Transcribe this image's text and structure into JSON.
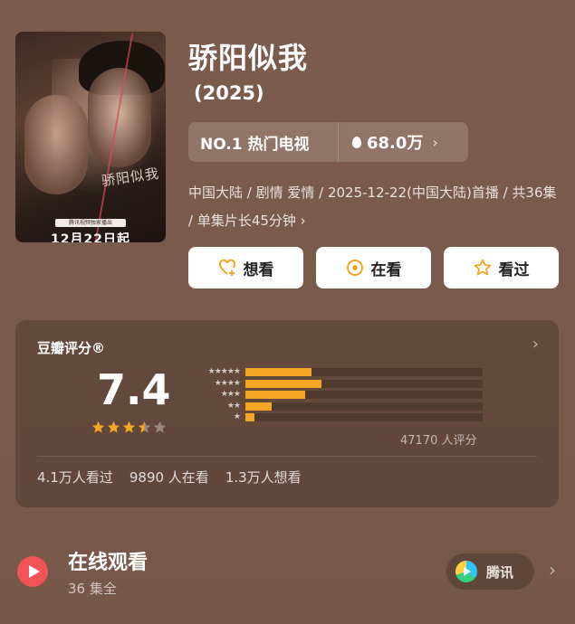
{
  "poster": {
    "calligraphy": "骄阳似我",
    "banner_text": "腾讯视频独家播出",
    "release_date": "12月22日起"
  },
  "title": "骄阳似我",
  "year": "(2025)",
  "ranking": {
    "label": "NO.1 热门电视",
    "heat": "68.0万",
    "heat_chevron": "›"
  },
  "meta": "中国大陆 / 剧情 爱情 / 2025-12-22(中国大陆)首播 / 共36集 / 单集片长45分钟 ›",
  "actions": [
    {
      "label": "想看",
      "icon": "heart-plus-icon",
      "color": "#f5a623"
    },
    {
      "label": "在看",
      "icon": "target-icon",
      "color": "#f5a623"
    },
    {
      "label": "看过",
      "icon": "star-outline-icon",
      "color": "#f5a623"
    }
  ],
  "rating": {
    "title": "豆瓣评分®",
    "chevron": "›",
    "score": "7.4",
    "stars_value": 3.5,
    "distribution": [
      {
        "stars": "★★★★★",
        "fraction": 0.28
      },
      {
        "stars": "★★★★",
        "fraction": 0.32
      },
      {
        "stars": "★★★",
        "fraction": 0.25
      },
      {
        "stars": "★★",
        "fraction": 0.11
      },
      {
        "stars": "★",
        "fraction": 0.04
      }
    ],
    "votes": "47170 人评分",
    "stats": [
      "4.1万人看过",
      "9890 人在看",
      "1.3万人想看"
    ],
    "accent": "#f5a623"
  },
  "watch": {
    "title": "在线观看",
    "subtitle": "36 集全",
    "platform": "腾讯",
    "chevron": "›",
    "play_color": "#f05454"
  }
}
